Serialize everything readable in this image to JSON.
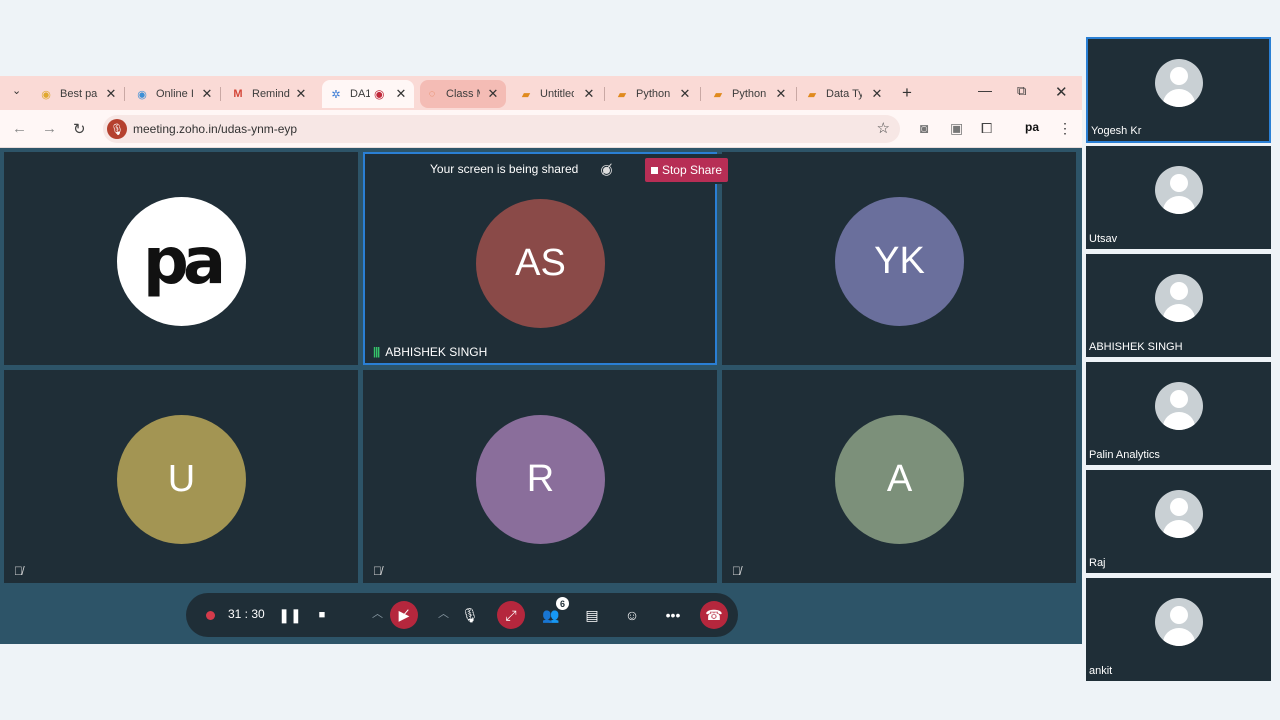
{
  "browser": {
    "tabs": [
      {
        "title": "Best pa",
        "icon": "colorful-ring-icon"
      },
      {
        "title": "Online I",
        "icon": "colorful-ring-icon"
      },
      {
        "title": "Remind",
        "icon": "gmail-icon"
      },
      {
        "title": "DA1",
        "icon": "zoho-meeting-icon",
        "active": true
      },
      {
        "title": "Class M",
        "icon": "loading-icon",
        "hover": true
      },
      {
        "title": "Untitled",
        "icon": "notebook-icon"
      },
      {
        "title": "PythonF",
        "icon": "notebook-icon"
      },
      {
        "title": "PythonF",
        "icon": "notebook-icon"
      },
      {
        "title": "Data Ty",
        "icon": "notebook-icon"
      }
    ],
    "url": "meeting.zoho.in/udas-ynm-eyp"
  },
  "share_banner": {
    "text": "Your screen is being shared",
    "stop_label": "Stop Share"
  },
  "tiles": [
    {
      "kind": "logo",
      "logo_text": "pa"
    },
    {
      "initials": "AS",
      "color": "#8a4a48",
      "name": "ABHISHEK SINGH",
      "speaking": true
    },
    {
      "initials": "YK",
      "color": "#6a6f9c"
    },
    {
      "initials": "U",
      "color": "#a39553",
      "muted": true
    },
    {
      "initials": "R",
      "color": "#8a6e9b",
      "muted": true
    },
    {
      "initials": "A",
      "color": "#7c907a",
      "muted": true
    }
  ],
  "controls": {
    "timer": "31 : 30",
    "participant_count": "6"
  },
  "sidebar": [
    {
      "name": "Yogesh Kr"
    },
    {
      "name": "Utsav"
    },
    {
      "name": "ABHISHEK SINGH"
    },
    {
      "name": "Palin Analytics"
    },
    {
      "name": "Raj"
    },
    {
      "name": "ankit"
    }
  ]
}
